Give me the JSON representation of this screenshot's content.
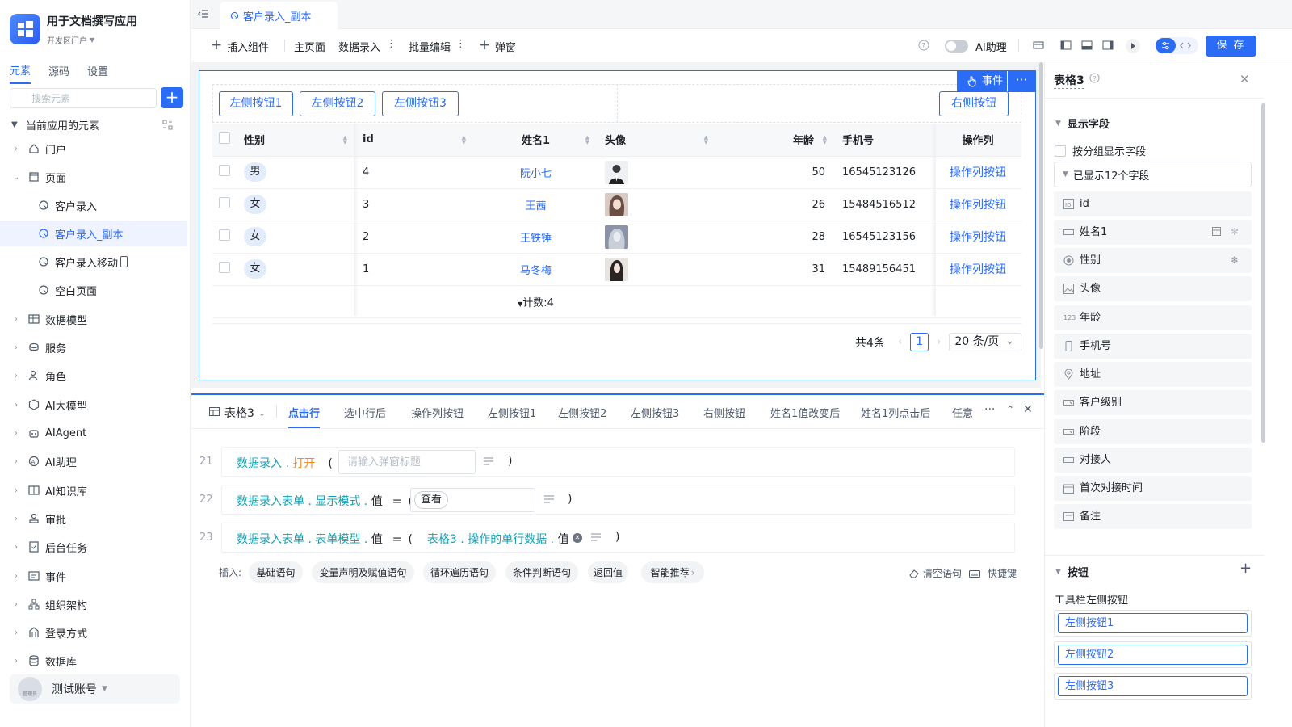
{
  "app": {
    "title": "用于文档撰写应用",
    "portal": "开发区门户"
  },
  "sidebar": {
    "tabs": [
      "元素",
      "源码",
      "设置"
    ],
    "search_placeholder": "搜索元素",
    "section_title": "当前应用的元素",
    "items": [
      {
        "label": "门户",
        "icon": "home-icon"
      },
      {
        "label": "页面",
        "icon": "page-icon"
      },
      {
        "label": "客户录入",
        "icon": "page-doc-icon"
      },
      {
        "label": "客户录入_副本",
        "icon": "page-doc-icon"
      },
      {
        "label": "客户录入移动",
        "icon": "page-doc-icon"
      },
      {
        "label": "空白页面",
        "icon": "page-doc-icon"
      },
      {
        "label": "数据模型",
        "icon": "table-icon"
      },
      {
        "label": "服务",
        "icon": "service-icon"
      },
      {
        "label": "角色",
        "icon": "role-icon"
      },
      {
        "label": "AI大模型",
        "icon": "ai-model-icon"
      },
      {
        "label": "AIAgent",
        "icon": "robot-icon"
      },
      {
        "label": "AI助理",
        "icon": "ai-assistant-icon"
      },
      {
        "label": "AI知识库",
        "icon": "book-icon"
      },
      {
        "label": "审批",
        "icon": "approval-icon"
      },
      {
        "label": "后台任务",
        "icon": "task-icon"
      },
      {
        "label": "事件",
        "icon": "event-icon"
      },
      {
        "label": "组织架构",
        "icon": "org-icon"
      },
      {
        "label": "登录方式",
        "icon": "login-icon"
      },
      {
        "label": "数据库",
        "icon": "database-icon"
      }
    ],
    "account": {
      "name": "测试账号",
      "role": "管理员"
    }
  },
  "tabbar": {
    "active_tab": "客户录入_副本"
  },
  "toolbar": {
    "insert": "插入组件",
    "main_page": "主页面",
    "data_entry": "数据录入",
    "batch_edit": "批量编辑",
    "popup": "弹窗",
    "ai_assistant": "AI助理",
    "save": "保 存"
  },
  "canvas": {
    "left_buttons": [
      "左侧按钮1",
      "左侧按钮2",
      "左侧按钮3"
    ],
    "right_button": "右侧按钮",
    "event_label": "事件",
    "table": {
      "columns": [
        "性别",
        "id",
        "姓名1",
        "头像",
        "年龄",
        "手机号",
        "操作列"
      ],
      "rows": [
        {
          "gender": "男",
          "id": "4",
          "name": "阮小七",
          "age": "50",
          "phone": "16545123126",
          "action": "操作列按钮"
        },
        {
          "gender": "女",
          "id": "3",
          "name": "王茜",
          "age": "26",
          "phone": "15484516512",
          "action": "操作列按钮"
        },
        {
          "gender": "女",
          "id": "2",
          "name": "王铁锤",
          "age": "28",
          "phone": "16545123156",
          "action": "操作列按钮"
        },
        {
          "gender": "女",
          "id": "1",
          "name": "马冬梅",
          "age": "31",
          "phone": "15489156451",
          "action": "操作列按钮"
        }
      ],
      "count_label": "计数:4"
    },
    "pager": {
      "total": "共4条",
      "page": "1",
      "page_size": "20 条/页"
    }
  },
  "event_panel": {
    "component": "表格3",
    "tabs": [
      "点击行",
      "选中行后",
      "操作列按钮",
      "左侧按钮1",
      "左侧按钮2",
      "左侧按钮3",
      "右侧按钮",
      "姓名1值改变后",
      "姓名1列点击后",
      "任意"
    ],
    "statements": [
      {
        "line": "21",
        "obj": "数据录入",
        "method": "打开",
        "placeholder": "请输入弹窗标题"
      },
      {
        "line": "22",
        "obj": "数据录入表单",
        "prop": "显示模式",
        "val": "值",
        "value": "查看"
      },
      {
        "line": "23",
        "obj": "数据录入表单",
        "prop": "表单模型",
        "val": "值",
        "rhs_obj": "表格3",
        "rhs_prop": "操作的单行数据",
        "rhs_val": "值"
      }
    ],
    "insert_label": "插入:",
    "chips": [
      "基础语句",
      "变量声明及赋值语句",
      "循环遍历语句",
      "条件判断语句",
      "返回值",
      "智能推荐"
    ],
    "clear": "清空语句",
    "shortcut": "快捷键"
  },
  "right_panel": {
    "title": "表格3",
    "display_fields_title": "显示字段",
    "group_checkbox": "按分组显示字段",
    "shown_count": "已显示12个字段",
    "fields": [
      {
        "label": "id",
        "icon": "id-icon"
      },
      {
        "label": "姓名1",
        "icon": "text-field-icon"
      },
      {
        "label": "性别",
        "icon": "radio-icon"
      },
      {
        "label": "头像",
        "icon": "image-icon"
      },
      {
        "label": "年龄",
        "icon": "number-icon"
      },
      {
        "label": "手机号",
        "icon": "phone-icon"
      },
      {
        "label": "地址",
        "icon": "location-icon"
      },
      {
        "label": "客户级别",
        "icon": "select-icon"
      },
      {
        "label": "阶段",
        "icon": "select-icon"
      },
      {
        "label": "对接人",
        "icon": "text-field-icon"
      },
      {
        "label": "首次对接时间",
        "icon": "calendar-icon"
      },
      {
        "label": "备注",
        "icon": "textarea-icon"
      }
    ],
    "buttons_title": "按钮",
    "toolbar_left_label": "工具栏左侧按钮",
    "buttons": [
      "左侧按钮1",
      "左侧按钮2",
      "左侧按钮3"
    ]
  },
  "colors": {
    "accent": "#2a6cf6",
    "teal": "#14a0b4",
    "orange": "#f08a24"
  }
}
